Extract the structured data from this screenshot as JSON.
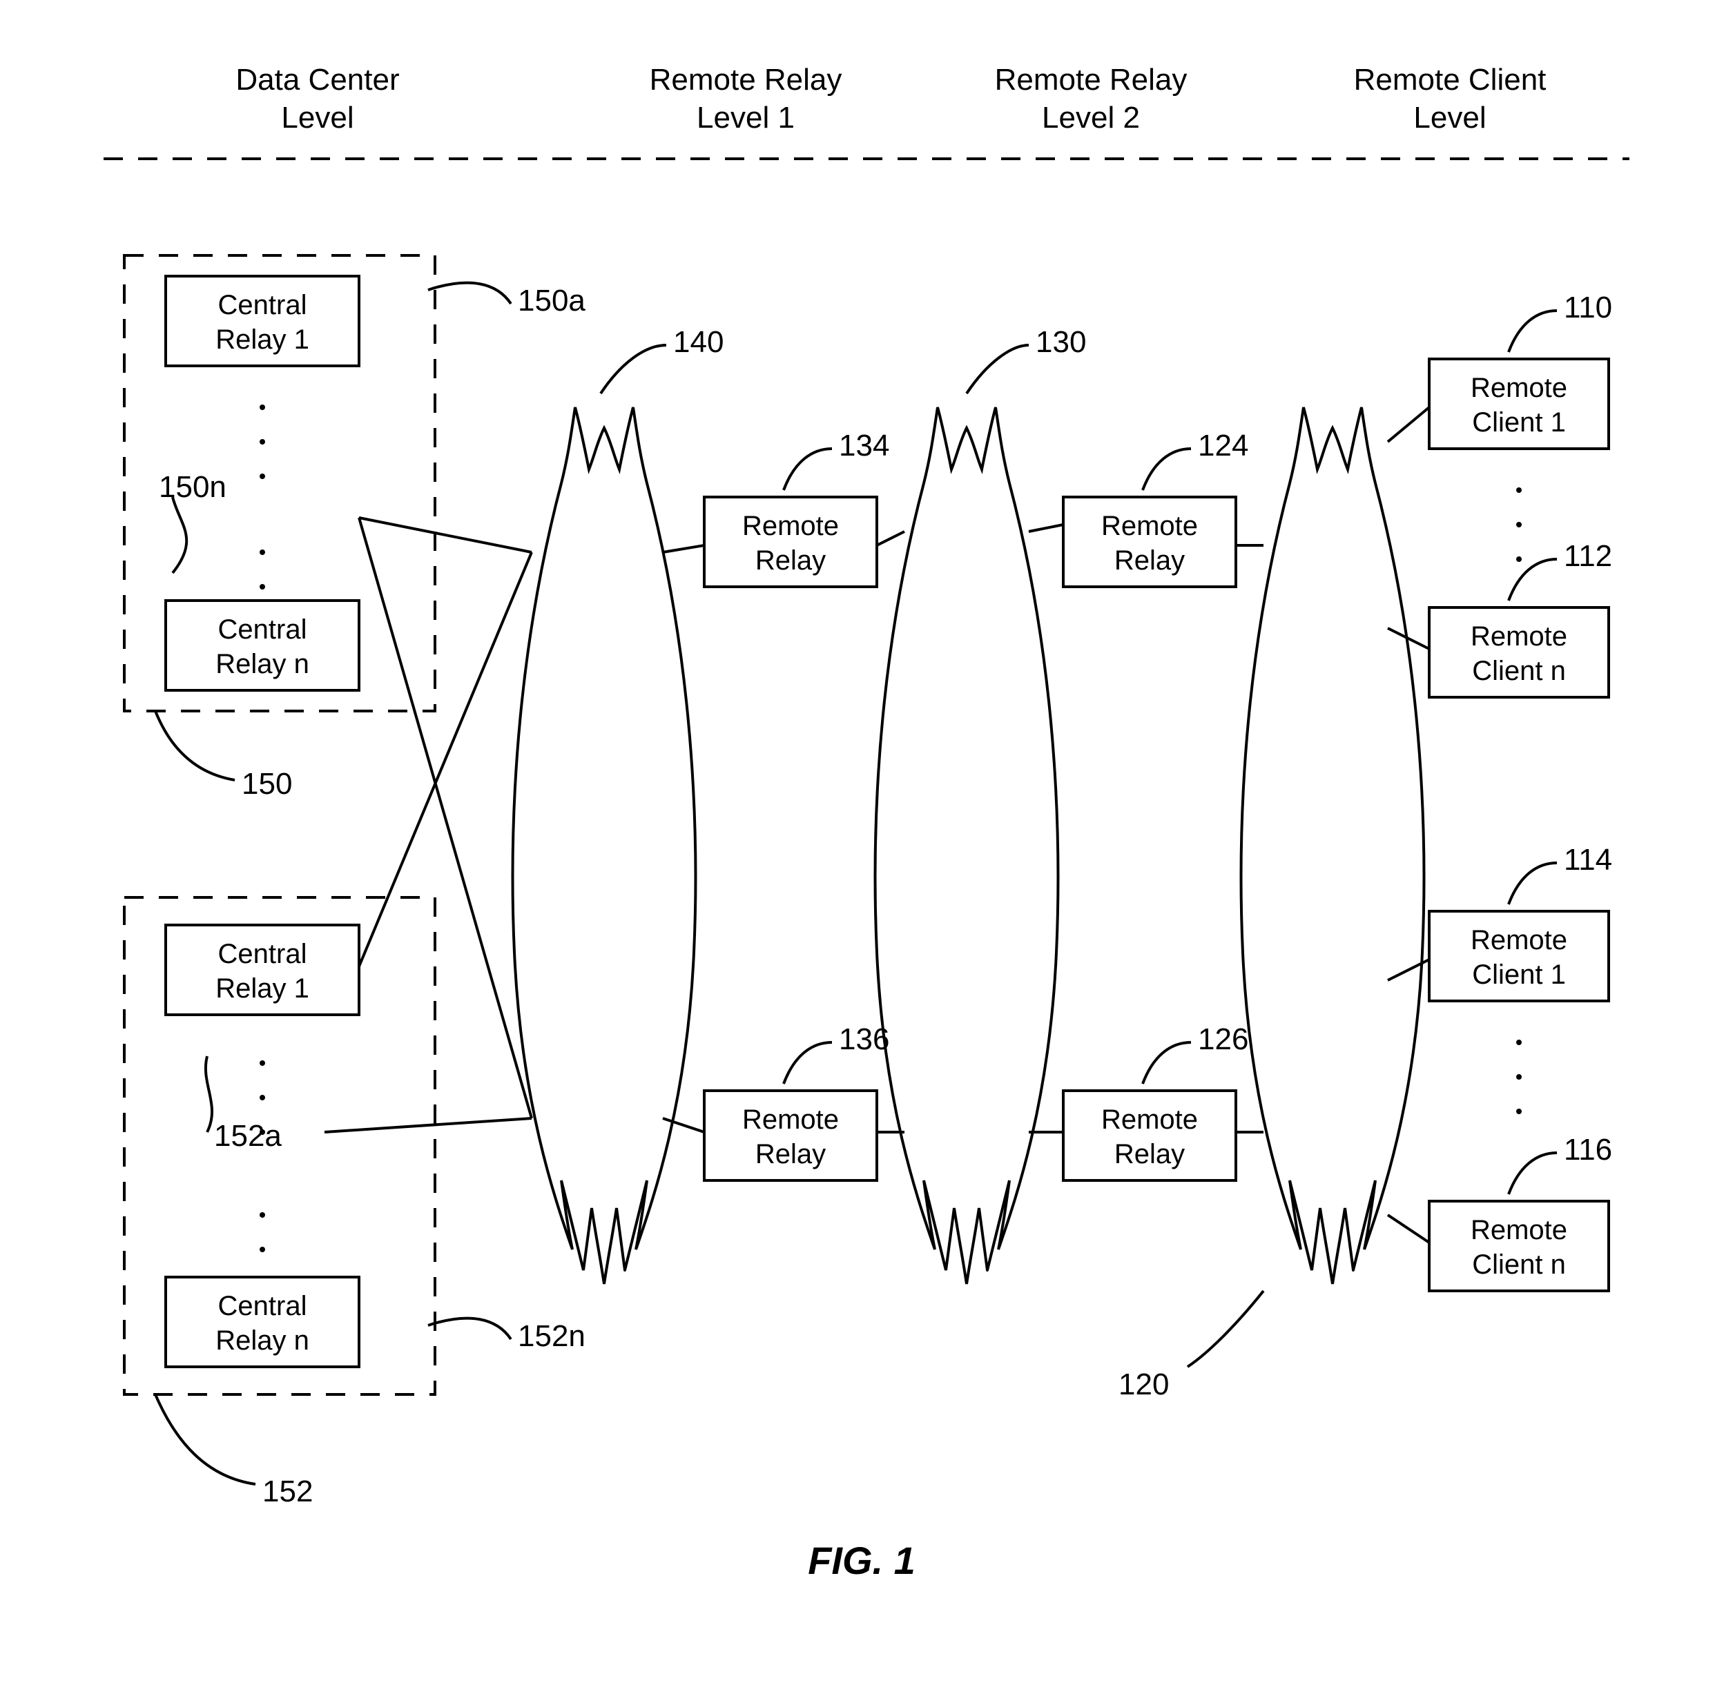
{
  "headers": {
    "col1_l1": "Data Center",
    "col1_l2": "Level",
    "col2_l1": "Remote Relay",
    "col2_l2": "Level 1",
    "col3_l1": "Remote Relay",
    "col3_l2": "Level 2",
    "col4_l1": "Remote Client",
    "col4_l2": "Level"
  },
  "boxes": {
    "central_relay_1_top_l1": "Central",
    "central_relay_1_top_l2": "Relay 1",
    "central_relay_n_top_l1": "Central",
    "central_relay_n_top_l2": "Relay n",
    "central_relay_1_bot_l1": "Central",
    "central_relay_1_bot_l2": "Relay 1",
    "central_relay_n_bot_l1": "Central",
    "central_relay_n_bot_l2": "Relay n",
    "remote_relay_134_l1": "Remote",
    "remote_relay_134_l2": "Relay",
    "remote_relay_124_l1": "Remote",
    "remote_relay_124_l2": "Relay",
    "remote_relay_136_l1": "Remote",
    "remote_relay_136_l2": "Relay",
    "remote_relay_126_l1": "Remote",
    "remote_relay_126_l2": "Relay",
    "remote_client_110_l1": "Remote",
    "remote_client_110_l2": "Client 1",
    "remote_client_112_l1": "Remote",
    "remote_client_112_l2": "Client n",
    "remote_client_114_l1": "Remote",
    "remote_client_114_l2": "Client 1",
    "remote_client_116_l1": "Remote",
    "remote_client_116_l2": "Client n"
  },
  "refs": {
    "r150a": "150a",
    "r150n": "150n",
    "r150": "150",
    "r152a": "152a",
    "r152n": "152n",
    "r152": "152",
    "r140": "140",
    "r130": "130",
    "r120": "120",
    "r134": "134",
    "r136": "136",
    "r124": "124",
    "r126": "126",
    "r110": "110",
    "r112": "112",
    "r114": "114",
    "r116": "116"
  },
  "caption": "FIG. 1"
}
